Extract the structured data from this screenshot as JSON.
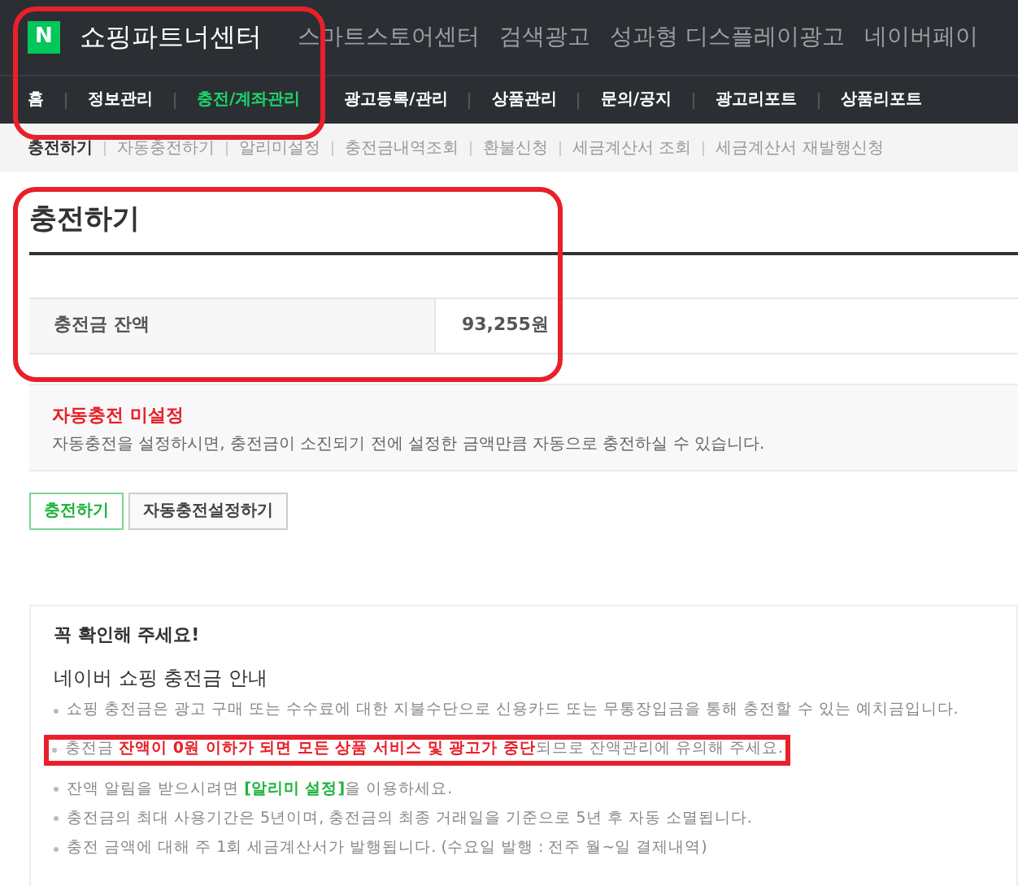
{
  "header": {
    "logo_letter": "N",
    "title": "쇼핑파트너센터",
    "links": [
      "스마트스토어센터",
      "검색광고",
      "성과형 디스플레이광고",
      "네이버페이"
    ]
  },
  "main_nav": [
    {
      "label": "홈",
      "selected": false
    },
    {
      "label": "정보관리",
      "selected": false
    },
    {
      "label": "충전/계좌관리",
      "selected": true
    },
    {
      "label": "광고등록/관리",
      "selected": false
    },
    {
      "label": "상품관리",
      "selected": false
    },
    {
      "label": "문의/공지",
      "selected": false
    },
    {
      "label": "광고리포트",
      "selected": false
    },
    {
      "label": "상품리포트",
      "selected": false
    }
  ],
  "sub_nav": [
    {
      "label": "충전하기",
      "selected": true
    },
    {
      "label": "자동충전하기",
      "selected": false
    },
    {
      "label": "알리미설정",
      "selected": false
    },
    {
      "label": "충전금내역조회",
      "selected": false
    },
    {
      "label": "환불신청",
      "selected": false
    },
    {
      "label": "세금계산서 조회",
      "selected": false
    },
    {
      "label": "세금계산서 재발행신청",
      "selected": false
    }
  ],
  "page_title": "충전하기",
  "balance": {
    "label": "충전금 잔액",
    "value": "93,255원"
  },
  "auto_charge": {
    "status": "자동충전 미설정",
    "description": "자동충전을 설정하시면, 충전금이 소진되기 전에 설정한 금액만큼 자동으로 충전하실 수 있습니다."
  },
  "buttons": [
    {
      "label": "충전하기",
      "kind": "primary"
    },
    {
      "label": "자동충전설정하기",
      "kind": "secondary"
    }
  ],
  "notice": {
    "heading": "꼭 확인해 주세요!",
    "title": "네이버 쇼핑 충전금 안내",
    "items": [
      {
        "parts": [
          {
            "text": "쇼핑 충전금은 광고 구매 또는 수수료에 대한 지불수단으로 신용카드 또는 무통장입금을 통해 충전할 수 있는 예치금입니다.",
            "kind": "plain"
          }
        ],
        "highlighted": false
      },
      {
        "parts": [
          {
            "text": "충전금 ",
            "kind": "plain"
          },
          {
            "text": "잔액이 0원 이하가 되면 모든 상품 서비스 및 광고가 중단",
            "kind": "alert"
          },
          {
            "text": "되므로 잔액관리에 유의해 주세요.",
            "kind": "plain"
          }
        ],
        "highlighted": true
      },
      {
        "parts": [
          {
            "text": "잔액 알림을 받으시려면 ",
            "kind": "plain"
          },
          {
            "text": "[알리미 설정]",
            "kind": "link"
          },
          {
            "text": "을 이용하세요.",
            "kind": "plain"
          }
        ],
        "highlighted": false
      },
      {
        "parts": [
          {
            "text": "충전금의 최대 사용기간은 5년이며, 충전금의 최종 거래일을 기준으로 5년 후 자동 소멸됩니다.",
            "kind": "plain"
          }
        ],
        "highlighted": false
      },
      {
        "parts": [
          {
            "text": "충전 금액에 대해 주 1회 세금계산서가 발행됩니다. (수요일 발행 : 전주 월~일 결제내역)",
            "kind": "plain"
          }
        ],
        "highlighted": false
      }
    ]
  }
}
